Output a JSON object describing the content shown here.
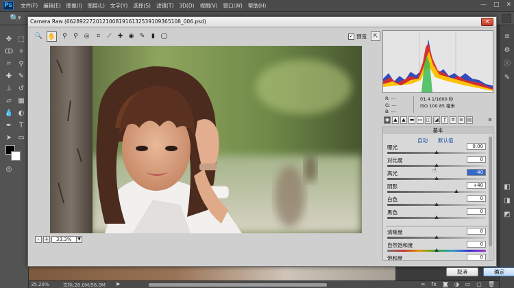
{
  "app": {
    "logo": "Ps",
    "menus": [
      "文件(F)",
      "编辑(E)",
      "图像(I)",
      "图层(L)",
      "文字(Y)",
      "选择(S)",
      "滤镜(T)",
      "3D(D)",
      "视图(V)",
      "窗口(W)",
      "帮助(H)"
    ],
    "window_controls": [
      "—",
      "□",
      "✕"
    ]
  },
  "options_bar": {
    "tool_icon": "zoom-icon"
  },
  "dialog": {
    "title": "Camera Raw (66289227201210081916132539109365108_006.psd)",
    "close_label": "✕",
    "preview_label": "预览",
    "preview_checked": true,
    "zoom_value": "33.3%",
    "zoom_minus": "-",
    "zoom_plus": "+",
    "cancel_label": "取消",
    "ok_label": "确定"
  },
  "readout": {
    "r": "R:  ---",
    "g": "G:  ---",
    "b": "B:  ---",
    "exif_line1": "f/1.4  1/1600 秒",
    "exif_line2": "ISO 100  85 毫米"
  },
  "panel": {
    "title": "基本",
    "auto_label": "自动",
    "default_label": "默认值",
    "sliders": [
      {
        "label": "曝光",
        "value": "0.00",
        "position": 0.5,
        "track": "plain"
      },
      {
        "label": "对比度",
        "value": "0",
        "position": 0.5,
        "track": "plain"
      },
      {
        "label": "高光",
        "value": "-40",
        "position": 0.5,
        "track": "plain",
        "selected": true
      },
      {
        "label": "阴影",
        "value": "+40",
        "position": 0.7,
        "track": "plain"
      },
      {
        "label": "白色",
        "value": "0",
        "position": 0.5,
        "track": "plain"
      },
      {
        "label": "黑色",
        "value": "0",
        "position": 0.5,
        "track": "plain"
      },
      {
        "label": "清晰度",
        "value": "0",
        "position": 0.5,
        "track": "plain"
      },
      {
        "label": "自然饱和度",
        "value": "0",
        "position": 0.5,
        "track": "rainbow"
      },
      {
        "label": "饱和度",
        "value": "0",
        "position": 0.5,
        "track": "rainbow"
      }
    ]
  },
  "status": {
    "zoom": "35.29%",
    "doc_info": "文档:28.0M/56.0M"
  },
  "colors": {
    "accent": "#3567c9",
    "link": "#1d4ea8",
    "ok_border": "#3d7bc4"
  }
}
